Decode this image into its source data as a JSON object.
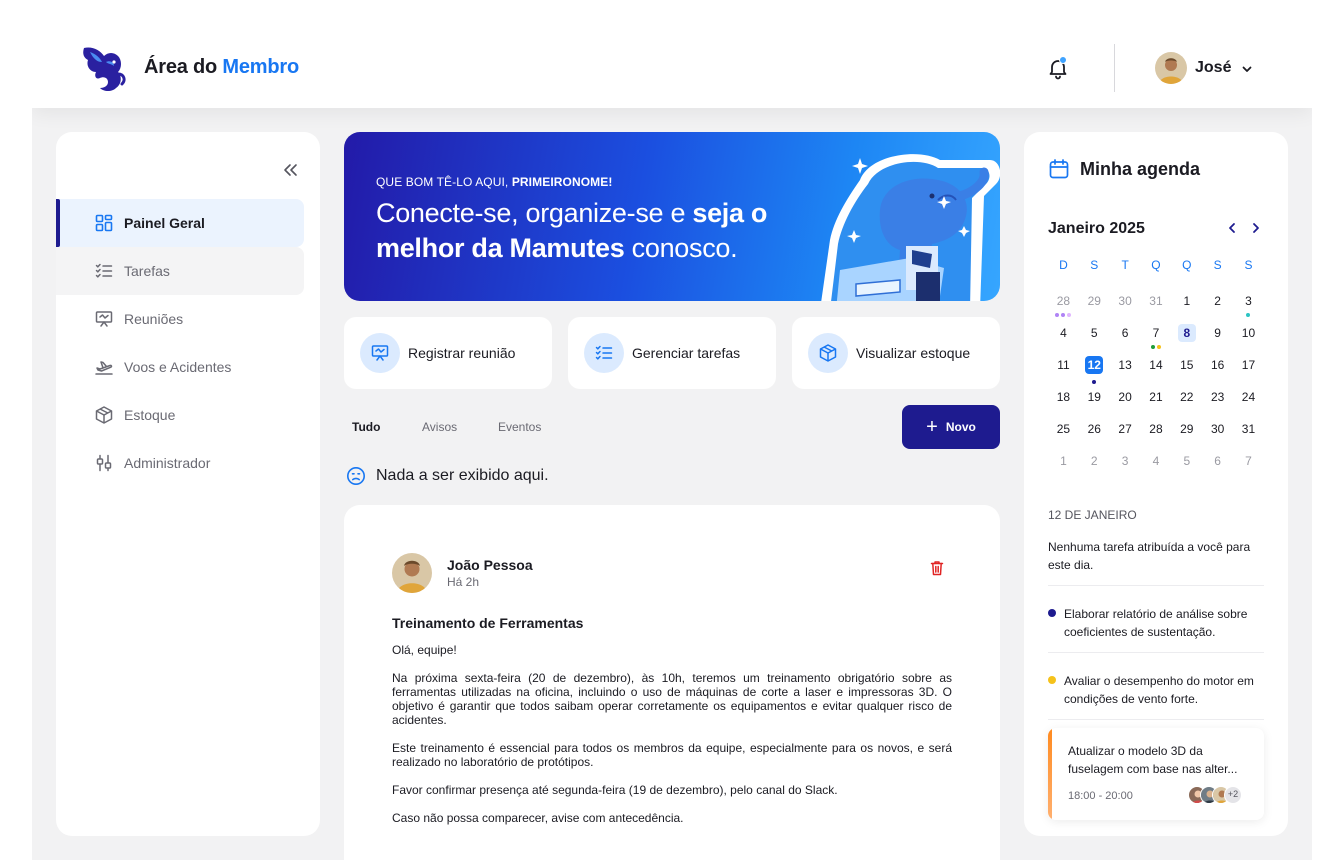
{
  "header": {
    "brand_prefix": "Área do ",
    "brand_accent": "Membro",
    "user_name": "José",
    "notification_dot_color": "#3fa3ff"
  },
  "sidebar": {
    "items": [
      {
        "label": "Painel Geral",
        "icon": "dashboard-icon",
        "active": true
      },
      {
        "label": "Tarefas",
        "icon": "tasks-icon"
      },
      {
        "label": "Reuniões",
        "icon": "presentation-icon"
      },
      {
        "label": "Voos e Acidentes",
        "icon": "airplane-icon"
      },
      {
        "label": "Estoque",
        "icon": "box-icon"
      },
      {
        "label": "Administrador",
        "icon": "sliders-icon"
      }
    ]
  },
  "hero": {
    "kicker_prefix": "QUE BOM TÊ-LO AQUI, ",
    "kicker_name": "PRIMEIRONOME!",
    "title_part1": "Conecte-se, organize-se e ",
    "title_bold1": "seja o melhor da Mamutes",
    "title_part2": " conosco."
  },
  "quick_actions": [
    {
      "label": "Registrar reunião",
      "icon": "presentation-icon"
    },
    {
      "label": "Gerenciar tarefas",
      "icon": "tasks-icon"
    },
    {
      "label": "Visualizar estoque",
      "icon": "box-icon"
    }
  ],
  "feed": {
    "tabs": [
      "Tudo",
      "Avisos",
      "Eventos"
    ],
    "active_tab": "Tudo",
    "new_button": "Novo",
    "empty_message": "Nada a ser exibido aqui."
  },
  "post": {
    "author": "João Pessoa",
    "time": "Há 2h",
    "title": "Treinamento de Ferramentas",
    "paragraphs": [
      "Olá, equipe!",
      "Na próxima sexta-feira (20 de dezembro), às 10h, teremos um treinamento obrigatório sobre as ferramentas utilizadas na oficina, incluindo o uso de máquinas de corte a laser e impressoras 3D. O objetivo é garantir que todos saibam operar corretamente os equipamentos e evitar qualquer risco de acidentes.",
      "Este treinamento é essencial para todos os membros da equipe, especialmente para os novos, e será realizado no laboratório de protótipos.",
      "Favor confirmar presença até segunda-feira (19 de dezembro), pelo canal do Slack.",
      "Caso não possa comparecer, avise com antecedência."
    ]
  },
  "agenda": {
    "title": "Minha agenda",
    "month": "Janeiro 2025",
    "weekdays": [
      "D",
      "S",
      "T",
      "Q",
      "Q",
      "S",
      "S"
    ],
    "weeks": [
      [
        "28",
        "29",
        "30",
        "31",
        "1",
        "2",
        "3"
      ],
      [
        "4",
        "5",
        "6",
        "7",
        "8",
        "9",
        "10"
      ],
      [
        "11",
        "12",
        "13",
        "14",
        "15",
        "16",
        "17"
      ],
      [
        "18",
        "19",
        "20",
        "21",
        "22",
        "23",
        "24"
      ],
      [
        "25",
        "26",
        "27",
        "28",
        "29",
        "30",
        "31"
      ],
      [
        "1",
        "2",
        "3",
        "4",
        "5",
        "6",
        "7"
      ]
    ],
    "selected_day": "12",
    "highlighted_day": "8",
    "date_label": "12 DE JANEIRO",
    "no_task": "Nenhuma tarefa atribuída a você para este dia.",
    "items": [
      {
        "text": "Elaborar relatório de análise sobre coeficientes de sustentação.",
        "color": "#1e1b8f"
      },
      {
        "text": "Avaliar o desempenho do motor em condições de vento forte.",
        "color": "#f5c21b"
      }
    ],
    "task_card": {
      "title": "Atualizar o modelo 3D da fuselagem com base nas alter...",
      "time": "18:00 - 20:00",
      "more": "+2"
    }
  }
}
